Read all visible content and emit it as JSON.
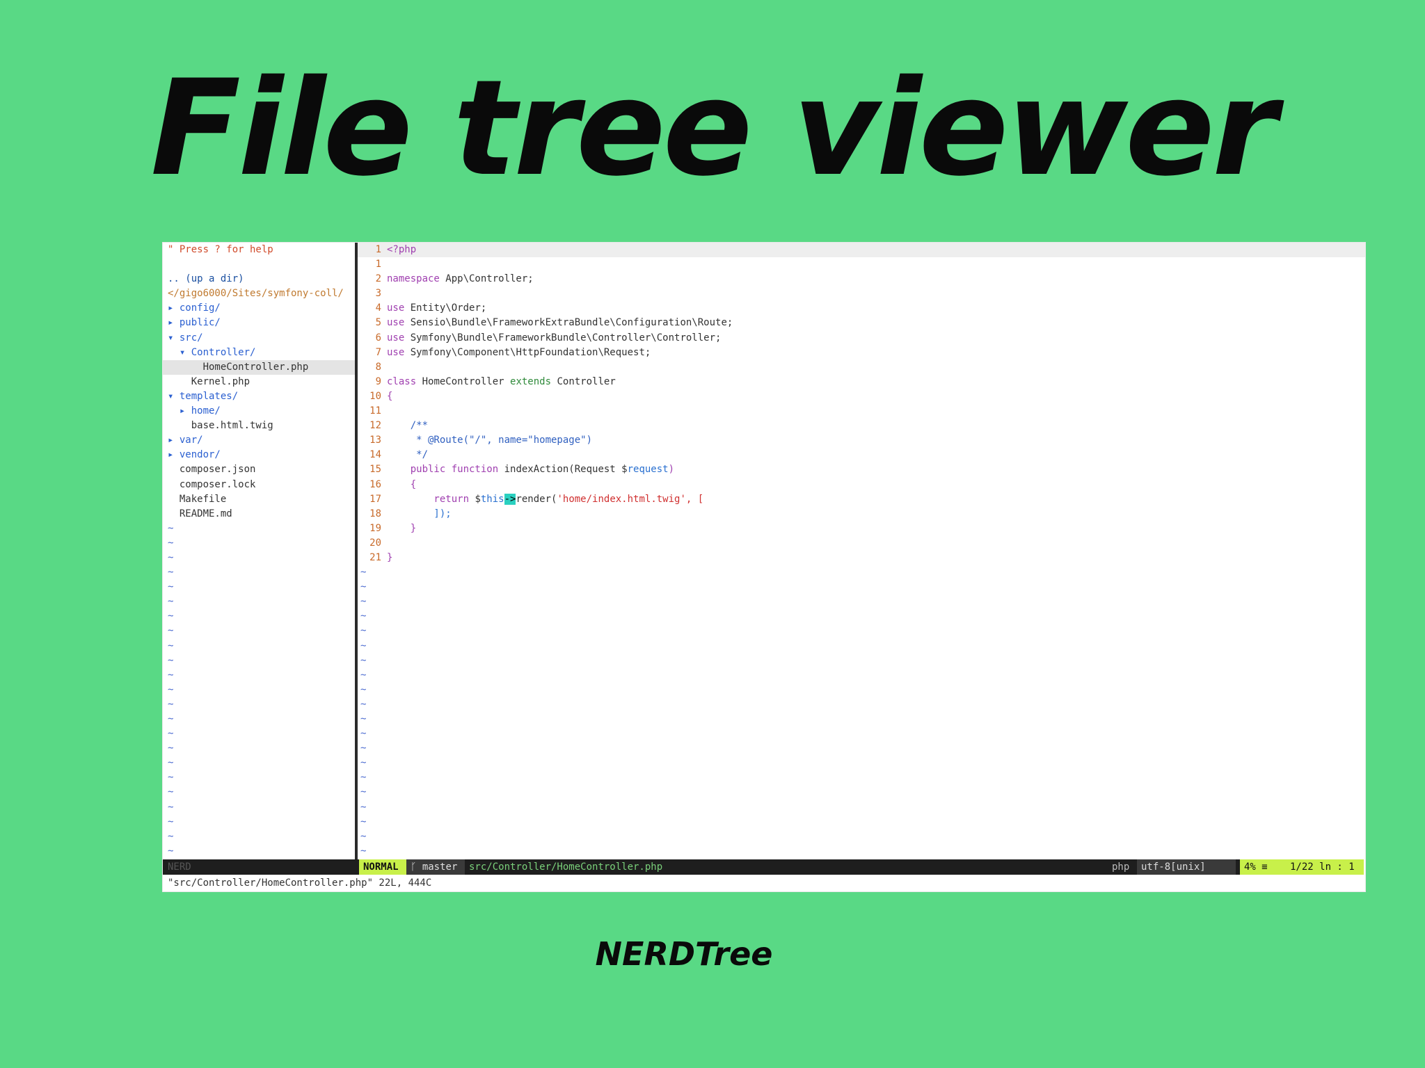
{
  "headline": "File tree viewer",
  "caption": "NERDTree",
  "colors": {
    "background": "#59d985",
    "statusline": "#1e1e1e",
    "mode_bg": "#c8f04a",
    "branch_bg": "#3a3a3a",
    "right_bg": "#c8f04a"
  },
  "tree": {
    "help": "\" Press ? for help",
    "blank": "",
    "up_dir": ".. (up a dir)",
    "root_path": "</gigo6000/Sites/symfony-coll/",
    "items": [
      {
        "text": "▸ config/",
        "kind": "dir"
      },
      {
        "text": "▸ public/",
        "kind": "dir"
      },
      {
        "text": "▾ src/",
        "kind": "dir"
      },
      {
        "text": "  ▾ Controller/",
        "kind": "dir"
      },
      {
        "text": "      HomeController.php",
        "kind": "file",
        "selected": true
      },
      {
        "text": "    Kernel.php",
        "kind": "file"
      },
      {
        "text": "▾ templates/",
        "kind": "dir"
      },
      {
        "text": "  ▸ home/",
        "kind": "dir"
      },
      {
        "text": "    base.html.twig",
        "kind": "file"
      },
      {
        "text": "▸ var/",
        "kind": "dir"
      },
      {
        "text": "▸ vendor/",
        "kind": "dir"
      },
      {
        "text": "  composer.json",
        "kind": "file"
      },
      {
        "text": "  composer.lock",
        "kind": "file"
      },
      {
        "text": "  Makefile",
        "kind": "file"
      },
      {
        "text": "  README.md",
        "kind": "file"
      }
    ],
    "tilde": "~"
  },
  "editor": {
    "lines": [
      {
        "num": "1",
        "parts": [
          {
            "t": "<?php",
            "c": "kw"
          }
        ]
      },
      {
        "num": "1",
        "parts": []
      },
      {
        "num": "2",
        "parts": [
          {
            "t": "namespace",
            "c": "kw"
          },
          {
            "t": " App\\Controller;",
            "c": ""
          }
        ]
      },
      {
        "num": "3",
        "parts": []
      },
      {
        "num": "4",
        "parts": [
          {
            "t": "use",
            "c": "kw"
          },
          {
            "t": " Entity\\Order;",
            "c": ""
          }
        ]
      },
      {
        "num": "5",
        "parts": [
          {
            "t": "use",
            "c": "kw"
          },
          {
            "t": " Sensio\\Bundle\\FrameworkExtraBundle\\Configuration\\Route;",
            "c": ""
          }
        ]
      },
      {
        "num": "6",
        "parts": [
          {
            "t": "use",
            "c": "kw"
          },
          {
            "t": " Symfony\\Bundle\\FrameworkBundle\\Controller\\Controller;",
            "c": ""
          }
        ]
      },
      {
        "num": "7",
        "parts": [
          {
            "t": "use",
            "c": "kw"
          },
          {
            "t": " Symfony\\Component\\HttpFoundation\\Request;",
            "c": ""
          }
        ]
      },
      {
        "num": "8",
        "parts": []
      },
      {
        "num": "9",
        "parts": [
          {
            "t": "class",
            "c": "kw"
          },
          {
            "t": " HomeController ",
            "c": ""
          },
          {
            "t": "extends",
            "c": "ty"
          },
          {
            "t": " Controller",
            "c": ""
          }
        ]
      },
      {
        "num": "10",
        "parts": [
          {
            "t": "{",
            "c": "kw"
          }
        ]
      },
      {
        "num": "11",
        "parts": []
      },
      {
        "num": "12",
        "parts": [
          {
            "t": "    /**",
            "c": "cm"
          }
        ]
      },
      {
        "num": "13",
        "parts": [
          {
            "t": "     * @Route(\"/\", name=\"homepage\")",
            "c": "cm"
          }
        ]
      },
      {
        "num": "14",
        "parts": [
          {
            "t": "     */",
            "c": "cm"
          }
        ]
      },
      {
        "num": "15",
        "parts": [
          {
            "t": "    public function",
            "c": "kw"
          },
          {
            "t": " indexAction(Request $",
            "c": ""
          },
          {
            "t": "request",
            "c": "var"
          },
          {
            "t": ")",
            "c": "kw"
          }
        ]
      },
      {
        "num": "16",
        "parts": [
          {
            "t": "    {",
            "c": "kw"
          }
        ]
      },
      {
        "num": "17",
        "parts": [
          {
            "t": "        return",
            "c": "kw"
          },
          {
            "t": " $",
            "c": ""
          },
          {
            "t": "this",
            "c": "var"
          },
          {
            "t": "->",
            "c": "cursor"
          },
          {
            "t": "render(",
            "c": ""
          },
          {
            "t": "'home/index.html.twig'",
            "c": "str"
          },
          {
            "t": ", [",
            "c": "str"
          }
        ]
      },
      {
        "num": "18",
        "parts": [
          {
            "t": "        ]);",
            "c": "var"
          }
        ]
      },
      {
        "num": "19",
        "parts": [
          {
            "t": "    }",
            "c": "kw"
          }
        ]
      },
      {
        "num": "20",
        "parts": []
      },
      {
        "num": "21",
        "parts": [
          {
            "t": "}",
            "c": "kw"
          }
        ]
      }
    ],
    "tilde": "~"
  },
  "status": {
    "tree_label": "NERD",
    "mode": "NORMAL",
    "branch": "ᚴ master",
    "file": "src/Controller/HomeController.php",
    "filetype": "php",
    "encoding": "utf-8[unix]",
    "percent": "4% ≡",
    "position": "1/22 ln : 1"
  },
  "message": "\"src/Controller/HomeController.php\" 22L, 444C"
}
